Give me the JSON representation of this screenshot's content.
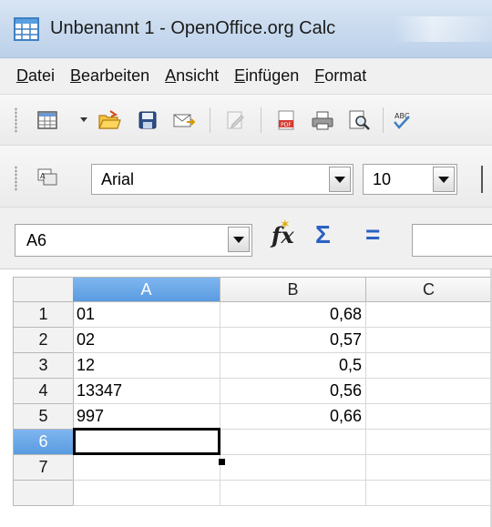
{
  "window": {
    "title": "Unbenannt 1 - OpenOffice.org Calc"
  },
  "menu": {
    "items": [
      {
        "acc": "D",
        "rest": "atei"
      },
      {
        "acc": "B",
        "rest": "earbeiten"
      },
      {
        "acc": "A",
        "rest": "nsicht"
      },
      {
        "acc": "E",
        "rest": "infügen"
      },
      {
        "acc": "F",
        "rest": "ormat"
      }
    ]
  },
  "formatting": {
    "font_name": "Arial",
    "font_size": "10"
  },
  "formula_bar": {
    "name_box": "A6",
    "fx_label": "fx",
    "sigma_label": "Σ",
    "equals_label": "="
  },
  "sheet": {
    "columns": [
      "A",
      "B",
      "C"
    ],
    "selected_column": "A",
    "rows": [
      {
        "num": "1",
        "a": "01",
        "b": "0,68"
      },
      {
        "num": "2",
        "a": "02",
        "b": "0,57"
      },
      {
        "num": "3",
        "a": "12",
        "b": "0,5"
      },
      {
        "num": "4",
        "a": "13347",
        "b": "0,56"
      },
      {
        "num": "5",
        "a": "997",
        "b": "0,66"
      },
      {
        "num": "6",
        "a": "",
        "b": ""
      },
      {
        "num": "7",
        "a": "",
        "b": ""
      }
    ],
    "active_cell": "A6"
  },
  "icons": {
    "app": "calc-app-icon",
    "toolbar": [
      "new-spreadsheet-icon",
      "open-folder-icon",
      "save-icon",
      "email-icon",
      "edit-file-icon",
      "export-pdf-icon",
      "print-icon",
      "page-preview-icon",
      "spellcheck-icon"
    ],
    "fmt": "styles-icon"
  },
  "colors": {
    "selection_header": "#5a9be0",
    "sigma": "#2b61c1"
  }
}
